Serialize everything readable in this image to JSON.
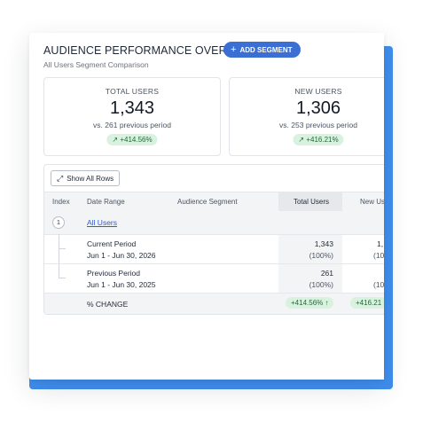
{
  "header": {
    "title": "AUDIENCE PERFORMANCE OVERVIEW",
    "subtitle": "All Users Segment Comparison",
    "add_segment_label": "ADD SEGMENT"
  },
  "kpis": [
    {
      "label": "TOTAL USERS",
      "value": "1,343",
      "previous": "vs. 261 previous period",
      "change": "↗ +414.56%"
    },
    {
      "label": "NEW USERS",
      "value": "1,306",
      "previous": "vs. 253 previous period",
      "change": "↗ +416.21%"
    }
  ],
  "table": {
    "show_all_label": "Show All Rows",
    "columns": [
      "Index",
      "Date Range",
      "Audience Segment",
      "Total Users",
      "New Us"
    ],
    "group": {
      "index": "1",
      "name": "All Users"
    },
    "rows": [
      {
        "label": "Current Period",
        "dates": "Jun 1 - Jun 30, 2026",
        "total": "1,343",
        "total_pct": "(100%)",
        "new": "1,",
        "new_pct": "(10"
      },
      {
        "label": "Previous Period",
        "dates": "Jun 1 - Jun 30, 2025",
        "total": "261",
        "total_pct": "(100%)",
        "new": "",
        "new_pct": "(10"
      }
    ],
    "change_row": {
      "label": "% CHANGE",
      "total_change": "+414.56% ↑",
      "new_change": "+416.21"
    }
  },
  "colors": {
    "accent": "#3b6fd4",
    "positive_bg": "#d9f2df",
    "positive_text": "#1f6b36",
    "backdrop": "#3f8ff0"
  }
}
